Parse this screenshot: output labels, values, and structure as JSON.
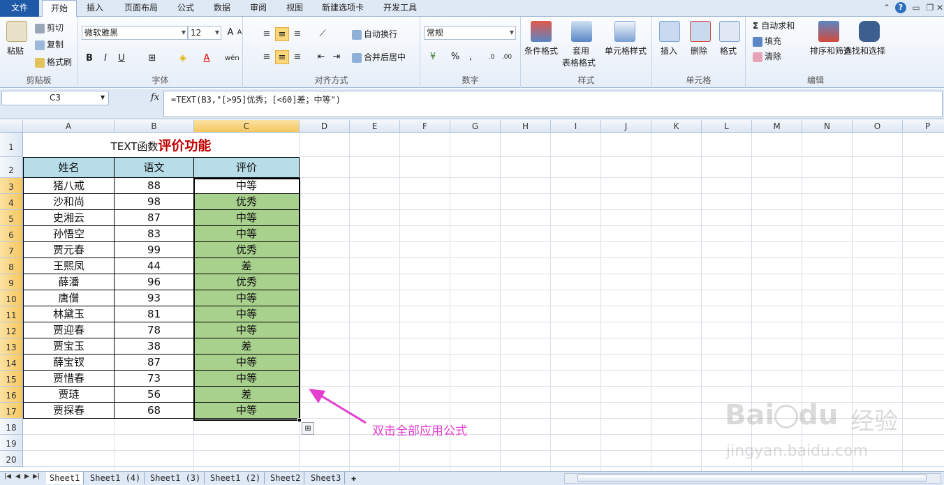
{
  "tabs": [
    "文件",
    "开始",
    "插入",
    "页面布局",
    "公式",
    "数据",
    "审阅",
    "视图",
    "新建选项卡",
    "开发工具"
  ],
  "ribbon": {
    "clipboard": {
      "paste": "粘贴",
      "cut": "剪切",
      "copy": "复制",
      "format_painter": "格式刷",
      "label": "剪贴板"
    },
    "font": {
      "name": "微软雅黑",
      "size": "12",
      "bold": "B",
      "italic": "I",
      "underline": "U",
      "label": "字体"
    },
    "align": {
      "wrap": "自动换行",
      "merge": "合并后居中",
      "label": "对齐方式"
    },
    "number": {
      "format": "常规",
      "percent": "%",
      "comma": ",",
      "label": "数字"
    },
    "styles": {
      "cond": "条件格式",
      "table_1": "套用",
      "table_2": "表格格式",
      "cell": "单元格样式",
      "label": "样式"
    },
    "cells": {
      "insert": "插入",
      "delete": "删除",
      "format": "格式",
      "label": "单元格"
    },
    "edit": {
      "autosum": "自动求和",
      "fill": "填充",
      "clear": "清除",
      "sort": "排序和筛选",
      "find": "查找和选择",
      "label": "编辑"
    }
  },
  "formula_bar": {
    "name_box": "C3",
    "fx": "fx",
    "formula": "=TEXT(B3,\"[>95]优秀；[<60]差；中等\")"
  },
  "columns": [
    "A",
    "B",
    "C",
    "D",
    "E",
    "F",
    "G",
    "H",
    "I",
    "J",
    "K",
    "L",
    "M",
    "N",
    "O",
    "P"
  ],
  "rows": [
    "1",
    "2",
    "3",
    "4",
    "5",
    "6",
    "7",
    "8",
    "9",
    "10",
    "11",
    "12",
    "13",
    "14",
    "15",
    "16",
    "17",
    "18",
    "19",
    "20"
  ],
  "title": {
    "part1": "TEXT函数",
    "part2": "评价功能"
  },
  "table": {
    "headers": [
      "姓名",
      "语文",
      "评价"
    ],
    "rows": [
      [
        "猪八戒",
        "88",
        "中等"
      ],
      [
        "沙和尚",
        "98",
        "优秀"
      ],
      [
        "史湘云",
        "87",
        "中等"
      ],
      [
        "孙悟空",
        "83",
        "中等"
      ],
      [
        "贾元春",
        "99",
        "优秀"
      ],
      [
        "王熙凤",
        "44",
        "差"
      ],
      [
        "薛潘",
        "96",
        "优秀"
      ],
      [
        "唐僧",
        "93",
        "中等"
      ],
      [
        "林黛玉",
        "81",
        "中等"
      ],
      [
        "贾迎春",
        "78",
        "中等"
      ],
      [
        "贾宝玉",
        "38",
        "差"
      ],
      [
        "薛宝钗",
        "87",
        "中等"
      ],
      [
        "贾惜春",
        "73",
        "中等"
      ],
      [
        "贾琏",
        "56",
        "差"
      ],
      [
        "贾探春",
        "68",
        "中等"
      ]
    ]
  },
  "annotation": "双击全部应用公式",
  "sheet_tabs": [
    "Sheet1",
    "Sheet1 (4)",
    "Sheet1 (3)",
    "Sheet1 (2)",
    "Sheet2",
    "Sheet3"
  ],
  "watermark": {
    "brand": "Bai",
    "brand2": "du",
    "cn": "经验",
    "url": "jingyan.baidu.com"
  },
  "colors": {
    "accent": "#1e5aa8",
    "header_fill": "#b7dde8",
    "green_fill": "#a9d18e",
    "title_red": "#c00000",
    "annotation": "#e23fcf"
  }
}
